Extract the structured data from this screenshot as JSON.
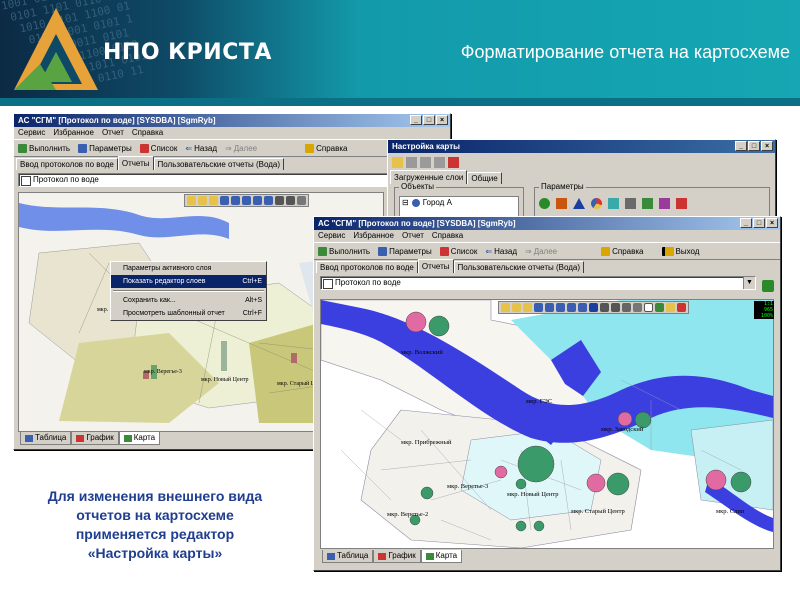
{
  "banner": {
    "logo_text": "НПО КРИСТА",
    "slide_title": "Форматирование отчета на картосхеме",
    "digits": "1001 0110 1100 0011\n 0101 1101 0110 10\n  1010 0101 1100 01\n   0110 1001 0101 1\n    1011 0011 0101\n     0101 1100 0110\n      0110 1011 0101\n       1001 0110 11",
    "colors": {
      "gradient_left": "#0c2a44",
      "gradient_right": "#15a7b3",
      "logo_orange": "#e8a23a",
      "logo_green": "#5aa342"
    }
  },
  "back_window": {
    "title": "АС \"СГМ\" [Протокол по воде] [SYSDBA] [SgmRyb]",
    "menu": [
      "Сервис",
      "Избранное",
      "Отчет",
      "Справка"
    ],
    "toolbar": [
      "Выполнить",
      "Параметры",
      "Список",
      "Назад",
      "Далее",
      "Справка"
    ],
    "tabs": [
      "Ввод протоколов по воде",
      "Отчеты",
      "Пользовательские отчеты (Вода)"
    ],
    "report_name": "Протокол по воде",
    "map_labels": [
      "мкр. Волжский",
      "мкр. Верегье-3",
      "мкр. Новый Центр",
      "мкр. Старый Центр"
    ],
    "bottom_tabs": [
      "Таблица",
      "График",
      "Карта"
    ],
    "context_menu": [
      {
        "label": "Параметры активного слоя",
        "shortcut": ""
      },
      {
        "label": "Показать редактор слоев",
        "shortcut": "Ctrl+E"
      },
      {
        "label": "Сохранить как...",
        "shortcut": "Alt+S"
      },
      {
        "label": "Просмотреть шаблонный отчет",
        "shortcut": "Ctrl+F"
      }
    ]
  },
  "settings_dialog": {
    "title": "Настройка карты",
    "tabs": [
      "Загруженные слои",
      "Общие"
    ],
    "objects_label": "Объекты",
    "params_label": "Параметры",
    "tree_item": "Город А"
  },
  "front_window": {
    "title": "АС \"СГМ\" [Протокол по воде] [SYSDBA] [SgmRyb]",
    "menu": [
      "Сервис",
      "Избранное",
      "Отчет",
      "Справка"
    ],
    "toolbar": {
      "run": "Выполнить",
      "params": "Параметры",
      "list": "Список",
      "back": "Назад",
      "forward": "Далее",
      "help": "Справка",
      "exit": "Выход"
    },
    "tabs": [
      "Ввод протоколов по воде",
      "Отчеты",
      "Пользовательские отчеты (Вода)"
    ],
    "report_name": "Протокол по воде",
    "map_labels": {
      "volzhsky": "мкр. Волжский",
      "ges": "мкр. ГЭС",
      "zavodskoy": "мкр. Заводский",
      "pribrezhny": "мкр. Прибрежный",
      "veretye3": "мкр. Веретье-3",
      "novy_centr": "мкр. Новый Центр",
      "veretye2": "мкр. Веретье-2",
      "stary_centr": "мкр. Старый Центр",
      "slip": "мкр. Слип"
    },
    "bottom_tabs": [
      "Таблица",
      "График",
      "Карта"
    ],
    "mini_indicator": [
      "1:1",
      "965",
      "100%"
    ]
  },
  "caption_lines": [
    "Для изменения внешнего вида",
    "отчетов на картосхеме",
    "применяется редактор",
    "«Настройка карты»"
  ]
}
